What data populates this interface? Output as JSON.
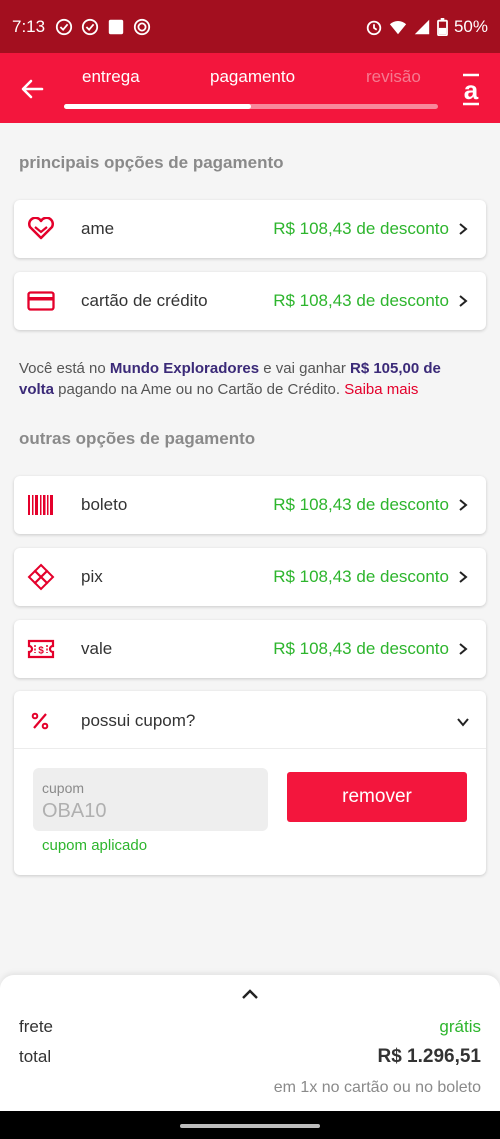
{
  "status_bar": {
    "time": "7:13",
    "battery": "50%",
    "icons_left": [
      "check-circle-icon",
      "check-circle-icon",
      "square-icon",
      "target-icon"
    ],
    "icons_right": [
      "alarm-icon",
      "wifi-icon",
      "signal-icon",
      "battery-icon"
    ]
  },
  "header": {
    "steps": [
      {
        "label": "entrega",
        "state": "done"
      },
      {
        "label": "pagamento",
        "state": "active"
      },
      {
        "label": "revisão",
        "state": "pending"
      }
    ],
    "progress": 0.5,
    "back_icon": "arrow-left-icon",
    "logo_icon": "americanas-logo-icon",
    "colors": {
      "bar": "#f3163d",
      "status": "#a30f1f"
    }
  },
  "sections": {
    "primary_title": "principais opções de pagamento",
    "other_title": "outras opções de pagamento"
  },
  "primary_options": [
    {
      "label": "ame",
      "discount": "R$ 108,43 de desconto",
      "icon": "ame-heart-icon"
    },
    {
      "label": "cartão de crédito",
      "discount": "R$ 108,43 de desconto",
      "icon": "credit-card-icon"
    }
  ],
  "info": {
    "part1": "Você está no ",
    "program": "Mundo Exploradores",
    "part2": " e vai ganhar ",
    "amount": "R$ 105,00 de volta",
    "part3": " pagando na Ame ou no Cartão de Crédito. ",
    "link": "Saiba mais"
  },
  "other_options": [
    {
      "label": "boleto",
      "discount": "R$ 108,43 de desconto",
      "icon": "barcode-icon"
    },
    {
      "label": "pix",
      "discount": "R$ 108,43 de desconto",
      "icon": "pix-icon"
    },
    {
      "label": "vale",
      "discount": "R$ 108,43 de desconto",
      "icon": "voucher-icon"
    }
  ],
  "coupon": {
    "title": "possui cupom?",
    "field_label": "cupom",
    "field_value": "OBA10",
    "remove_label": "remover",
    "status": "cupom aplicado",
    "icon": "percent-icon"
  },
  "summary": {
    "frete_label": "frete",
    "frete_value": "grátis",
    "total_label": "total",
    "total_value": "R$ 1.296,51",
    "note": "em 1x no cartão ou no boleto"
  },
  "colors": {
    "accent": "#f3163d",
    "discount": "#2db52d",
    "brand_text": "#3b2a78"
  }
}
